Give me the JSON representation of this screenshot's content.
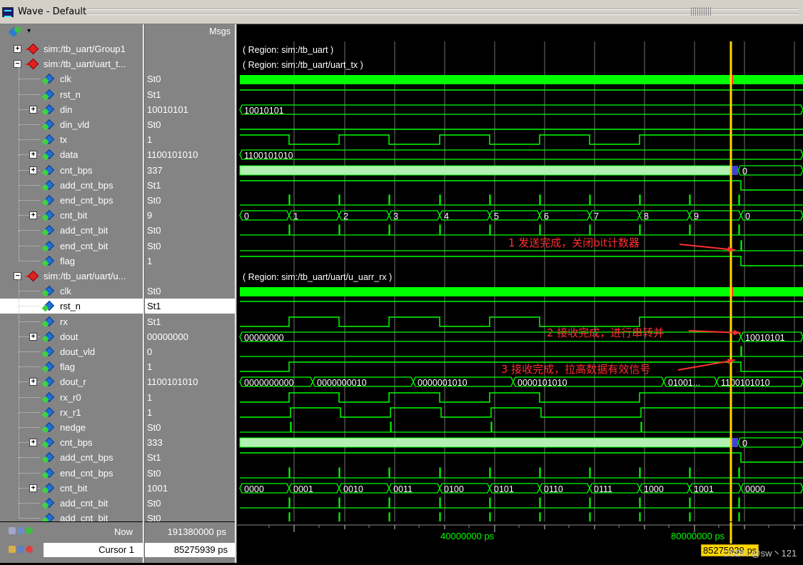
{
  "window": {
    "title": "Wave - Default"
  },
  "header": {
    "msgs_label": "Msgs"
  },
  "signals": [
    {
      "name": "sim:/tb_uart/Group1",
      "value": "",
      "kind": "group",
      "expander": "+",
      "indent": 0
    },
    {
      "name": "sim:/tb_uart/uart_t...",
      "value": "",
      "kind": "group",
      "expander": "-",
      "indent": 0
    },
    {
      "name": "clk",
      "value": "St0",
      "kind": "signal",
      "expander": "",
      "indent": 1
    },
    {
      "name": "rst_n",
      "value": "St1",
      "kind": "signal",
      "expander": "",
      "indent": 1
    },
    {
      "name": "din",
      "value": "10010101",
      "kind": "signal",
      "expander": "+",
      "indent": 1
    },
    {
      "name": "din_vld",
      "value": "St0",
      "kind": "signal",
      "expander": "",
      "indent": 1
    },
    {
      "name": "tx",
      "value": "1",
      "kind": "output",
      "expander": "",
      "indent": 1
    },
    {
      "name": "data",
      "value": "1100101010",
      "kind": "signal",
      "expander": "+",
      "indent": 1
    },
    {
      "name": "cnt_bps",
      "value": "337",
      "kind": "signal",
      "expander": "+",
      "indent": 1
    },
    {
      "name": "add_cnt_bps",
      "value": "St1",
      "kind": "signal",
      "expander": "",
      "indent": 1
    },
    {
      "name": "end_cnt_bps",
      "value": "St0",
      "kind": "signal",
      "expander": "",
      "indent": 1
    },
    {
      "name": "cnt_bit",
      "value": "9",
      "kind": "signal",
      "expander": "+",
      "indent": 1
    },
    {
      "name": "add_cnt_bit",
      "value": "St0",
      "kind": "signal",
      "expander": "",
      "indent": 1
    },
    {
      "name": "end_cnt_bit",
      "value": "St0",
      "kind": "signal",
      "expander": "",
      "indent": 1
    },
    {
      "name": "flag",
      "value": "1",
      "kind": "signal",
      "expander": "",
      "indent": 1
    },
    {
      "name": "sim:/tb_uart/uart/u...",
      "value": "",
      "kind": "group",
      "expander": "-",
      "indent": 0
    },
    {
      "name": "clk",
      "value": "St0",
      "kind": "signal",
      "expander": "",
      "indent": 1
    },
    {
      "name": "rst_n",
      "value": "St1",
      "kind": "signal",
      "expander": "",
      "indent": 1,
      "selected": true
    },
    {
      "name": "rx",
      "value": "St1",
      "kind": "signal",
      "expander": "",
      "indent": 1
    },
    {
      "name": "dout",
      "value": "00000000",
      "kind": "output",
      "expander": "+",
      "indent": 1
    },
    {
      "name": "dout_vld",
      "value": "0",
      "kind": "output",
      "expander": "",
      "indent": 1
    },
    {
      "name": "flag",
      "value": "1",
      "kind": "signal",
      "expander": "",
      "indent": 1
    },
    {
      "name": "dout_r",
      "value": "1100101010",
      "kind": "signal",
      "expander": "+",
      "indent": 1
    },
    {
      "name": "rx_r0",
      "value": "1",
      "kind": "signal",
      "expander": "",
      "indent": 1
    },
    {
      "name": "rx_r1",
      "value": "1",
      "kind": "signal",
      "expander": "",
      "indent": 1
    },
    {
      "name": "nedge",
      "value": "St0",
      "kind": "signal",
      "expander": "",
      "indent": 1
    },
    {
      "name": "cnt_bps",
      "value": "333",
      "kind": "signal",
      "expander": "+",
      "indent": 1
    },
    {
      "name": "add_cnt_bps",
      "value": "St1",
      "kind": "signal",
      "expander": "",
      "indent": 1
    },
    {
      "name": "end_cnt_bps",
      "value": "St0",
      "kind": "signal",
      "expander": "",
      "indent": 1
    },
    {
      "name": "cnt_bit",
      "value": "1001",
      "kind": "signal",
      "expander": "+",
      "indent": 1
    },
    {
      "name": "add_cnt_bit",
      "value": "St0",
      "kind": "signal",
      "expander": "",
      "indent": 1
    },
    {
      "name": "add_cnt_bit",
      "value": "St0",
      "kind": "signal",
      "expander": "",
      "indent": 1
    }
  ],
  "region_labels": {
    "row0": "( Region: sim:/tb_uart )",
    "row1": "( Region: sim:/tb_uart/uart_tx )",
    "row15": "( Region: sim:/tb_uart/uart/u_uarr_rx )"
  },
  "bus_values": {
    "din": [
      "10010101"
    ],
    "data": [
      "1100101010"
    ],
    "cnt_bps_tx_after": "0",
    "cnt_bit_tx": [
      "0",
      "1",
      "2",
      "3",
      "4",
      "5",
      "6",
      "7",
      "8",
      "9",
      "0"
    ],
    "dout": [
      "00000000",
      "10010101"
    ],
    "dout_r": [
      "0000000000",
      "0000000010",
      "0000001010",
      "0000101010",
      "01001...",
      "1100101010"
    ],
    "cnt_bps_rx_after": "0",
    "cnt_bit_rx": [
      "0000",
      "0001",
      "0010",
      "0011",
      "0100",
      "0101",
      "0110",
      "0111",
      "1000",
      "1001",
      "0000"
    ]
  },
  "annotations": [
    {
      "text": "1   发送完成，关闭bit计数器"
    },
    {
      "text": "2 接收完成，进行串转并"
    },
    {
      "text": "3 接收完成，拉高数据有效信号"
    }
  ],
  "bottom": {
    "now_label": "Now",
    "now_value": "191380000 ps",
    "cursor_label": "Cursor 1",
    "cursor_value": "85275939 ps",
    "timeline_labels": [
      "40000000 ps",
      "80000000 ps"
    ],
    "cursor_tag": "85275939 ps",
    "watermark": "CSDN @sw丶121"
  },
  "colors": {
    "wave_green": "#00ff00",
    "bus_fill": "#b4f0b4",
    "cursor": "#ffd700",
    "annotation": "#ff3030",
    "panel_gray": "#848484"
  }
}
